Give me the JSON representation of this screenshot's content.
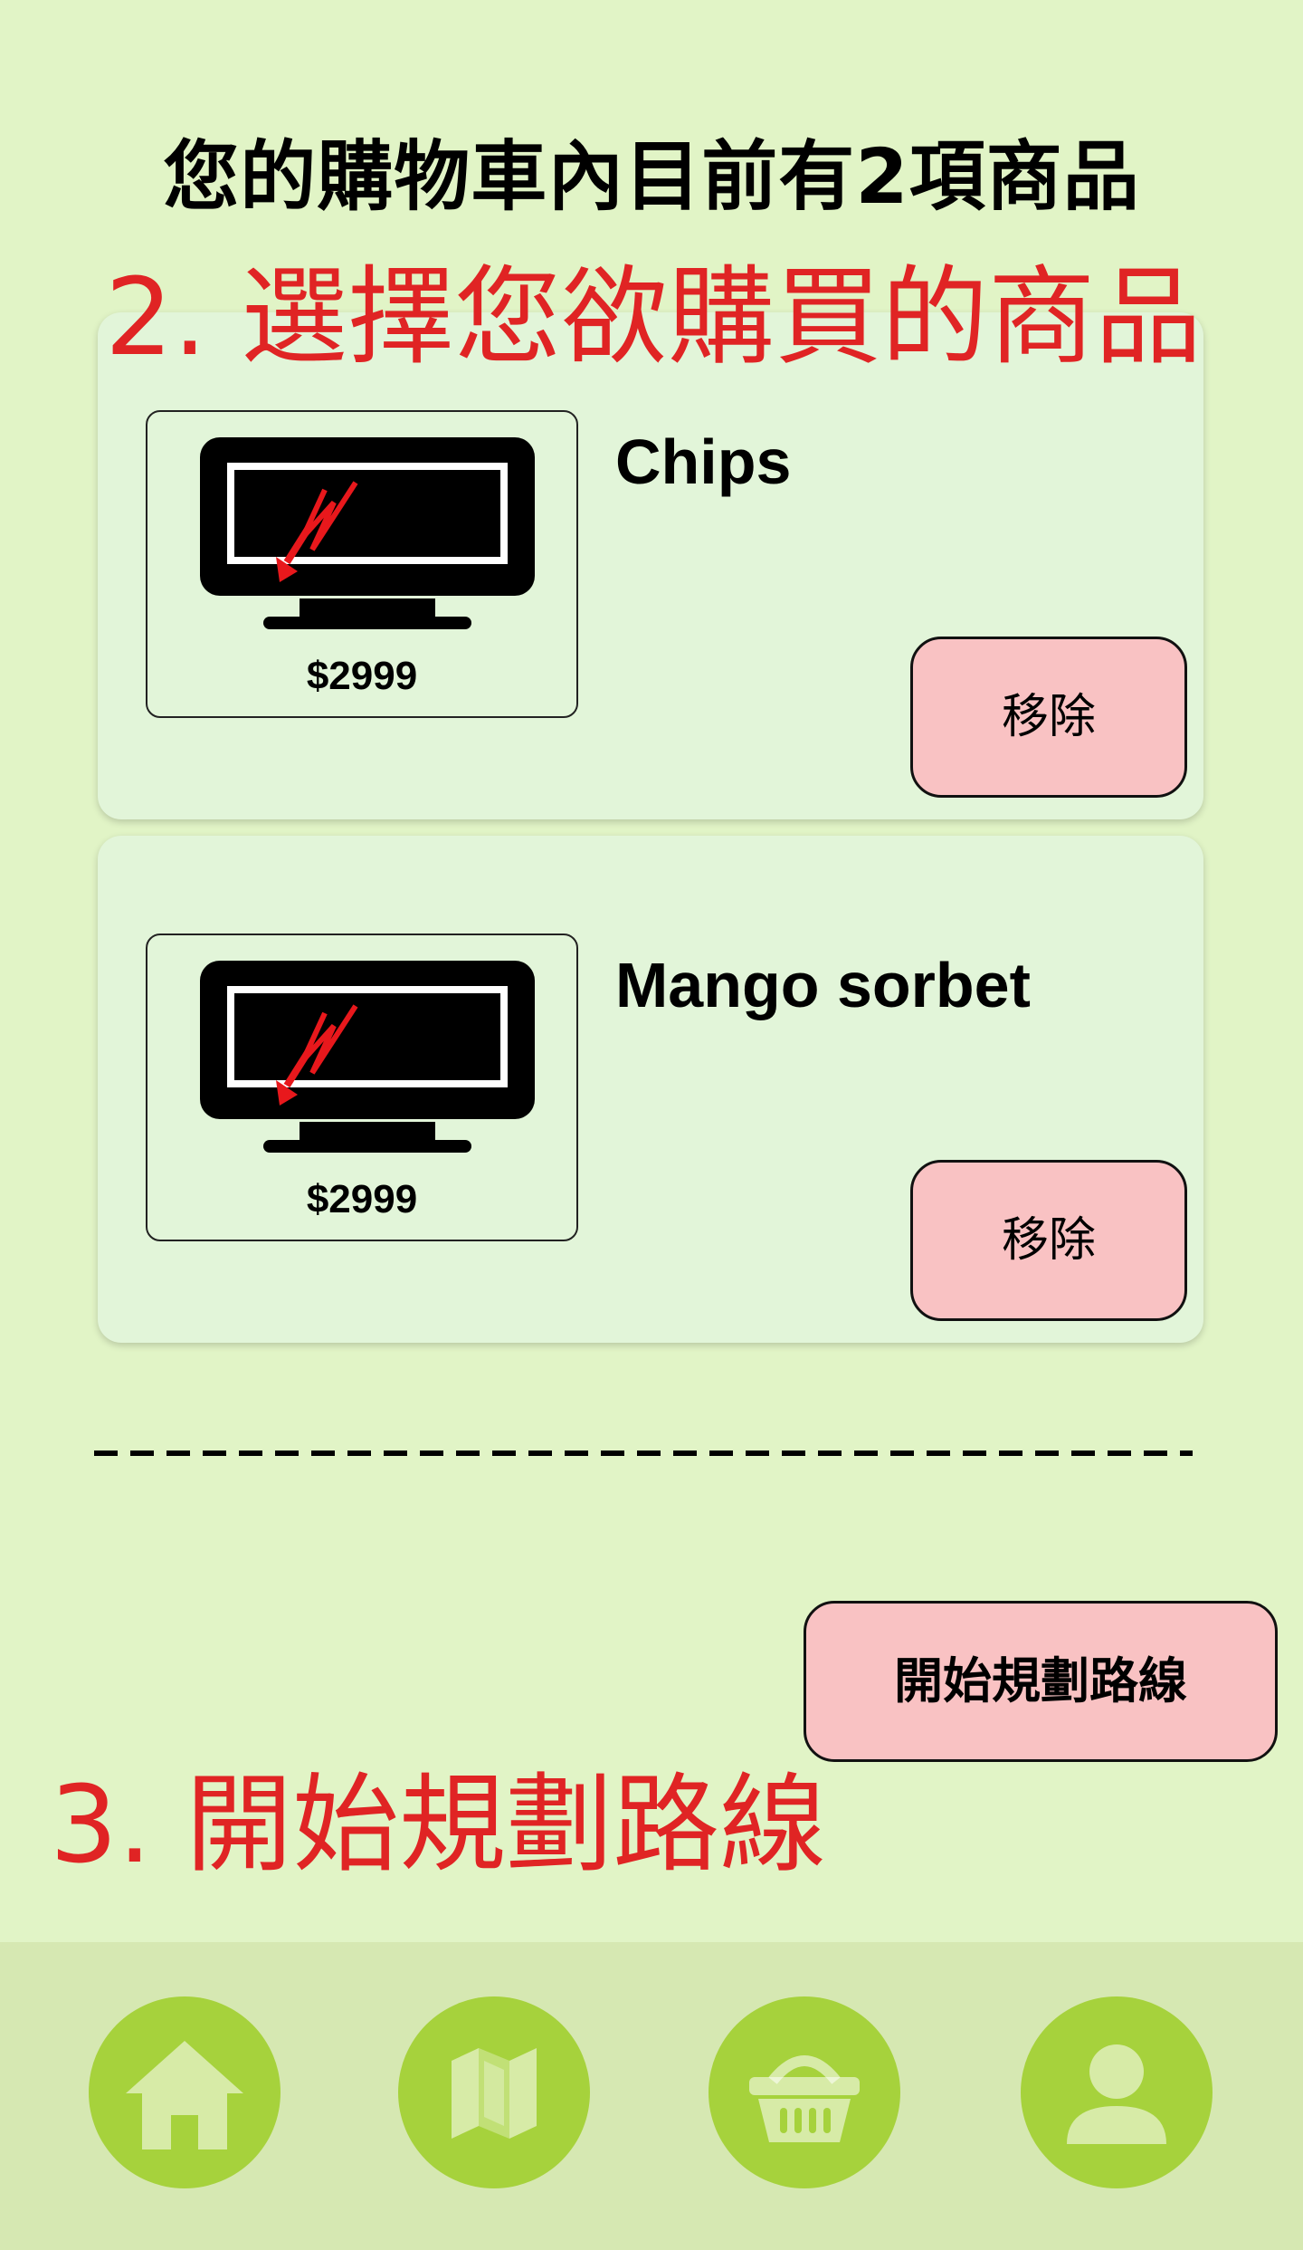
{
  "header": {
    "cart_summary": "您的購物車內目前有2項商品"
  },
  "annotations": {
    "step2": "2. 選擇您欲購買的商品",
    "step3": "3. 開始規劃路線",
    "color": "#e02424"
  },
  "cart_items": [
    {
      "name": "Chips",
      "price": "$2999",
      "image_icon": "monitor-icon",
      "remove_label": "移除"
    },
    {
      "name": "Mango sorbet",
      "price": "$2999",
      "image_icon": "monitor-icon",
      "remove_label": "移除"
    }
  ],
  "actions": {
    "plan_route_label": "開始規劃路線"
  },
  "bottom_nav": {
    "items": [
      {
        "icon": "home-icon"
      },
      {
        "icon": "map-icon"
      },
      {
        "icon": "basket-icon"
      },
      {
        "icon": "user-icon"
      }
    ]
  },
  "colors": {
    "background": "#e1f4c6",
    "card": "#e2f5d9",
    "button_pink": "#f9c2c3",
    "nav_accent": "#a6d23c",
    "nav_bar": "#d6e8b2"
  }
}
